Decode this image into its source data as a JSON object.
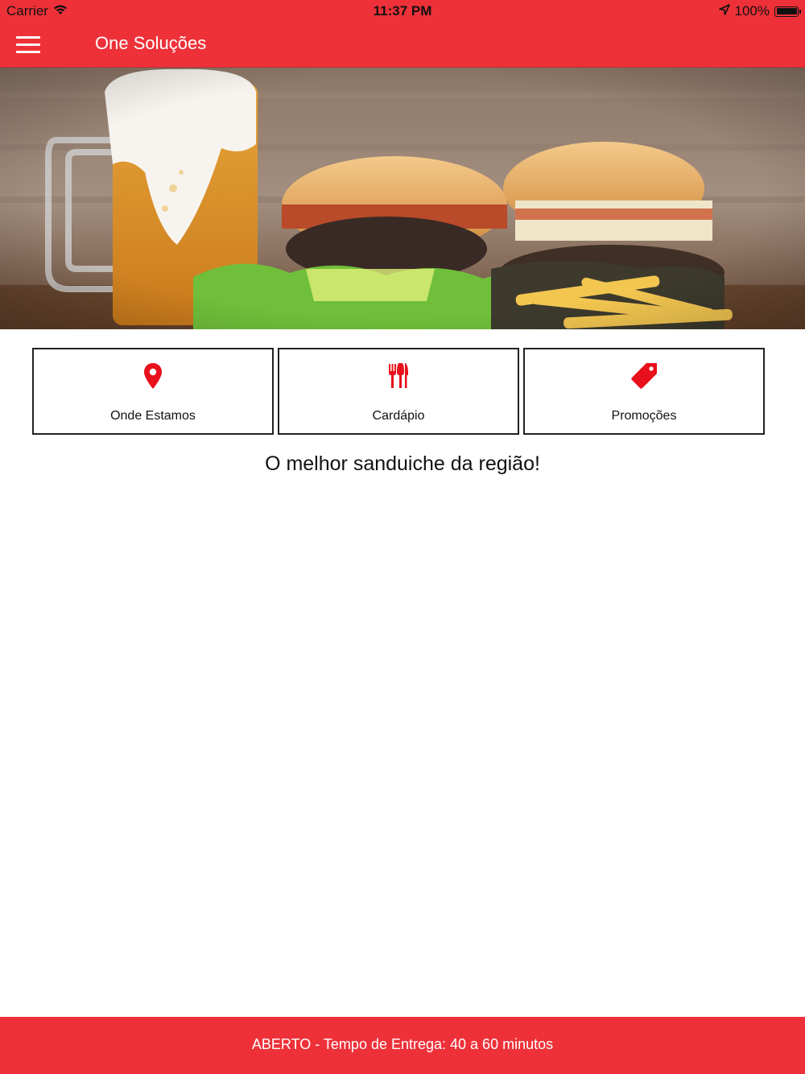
{
  "status_bar": {
    "carrier": "Carrier",
    "time": "11:37 PM",
    "battery": "100%",
    "icons": [
      "wifi-icon",
      "location-arrow-icon",
      "battery-icon"
    ]
  },
  "nav": {
    "title": "One Soluções",
    "menu_icon": "hamburger-menu-icon"
  },
  "hero": {
    "subject": "beer mug and two hamburgers with fries"
  },
  "actions": [
    {
      "label": "Onde Estamos",
      "icon": "map-pin-icon"
    },
    {
      "label": "Cardápio",
      "icon": "fork-knife-icon"
    },
    {
      "label": "Promoções",
      "icon": "price-tag-icon"
    }
  ],
  "tagline": "O melhor sanduiche da região!",
  "footer": {
    "status": "ABERTO - Tempo de Entrega: 40 a 60 minutos"
  },
  "colors": {
    "brand_red": "#ee3139",
    "icon_red": "#e8101b",
    "text": "#111111"
  }
}
